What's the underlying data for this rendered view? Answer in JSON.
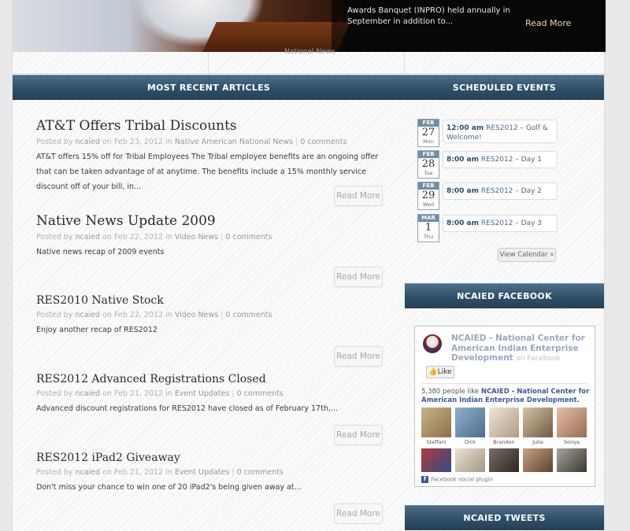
{
  "hero": {
    "caption_text": "Awards Banquet (INPRO) held annually in September in addition to...",
    "read_more": "Read More",
    "tab_label": "National News"
  },
  "sections": {
    "recent": "MOST RECENT ARTICLES",
    "events": "SCHEDULED EVENTS",
    "facebook": "NCAIED FACEBOOK",
    "tweets": "NCAIED TWEETS"
  },
  "articles": [
    {
      "title": "AT&T Offers Tribal Discounts",
      "posted_by": "Posted by",
      "author": "ncaied",
      "on": "on Feb 23, 2012 in",
      "category": "Native American National News",
      "comments": "0 comments",
      "excerpt": "AT&T offers 15% off for Tribal Employees The Tribal employee benefits are an ongoing offer that can be taken advantage of at anytime. The benefits include a 15% monthly service discount off of your bill, in...",
      "read_more": "Read More"
    },
    {
      "title": "Native News Update 2009",
      "posted_by": "Posted by",
      "author": "ncaied",
      "on": "on Feb 22, 2012 in",
      "category": "Video News",
      "comments": "0 comments",
      "excerpt": "Native news recap of 2009 events",
      "read_more": "Read More"
    },
    {
      "title": "RES2010 Native Stock",
      "posted_by": "Posted by",
      "author": "ncaied",
      "on": "on Feb 22, 2012 in",
      "category": "Video News",
      "comments": "0 comments",
      "excerpt": "Enjoy another recap of RES2012",
      "read_more": "Read More"
    },
    {
      "title": "RES2012 Advanced Registrations Closed",
      "posted_by": "Posted by",
      "author": "ncaied",
      "on": "on Feb 21, 2012 in",
      "category": "Event Updates",
      "comments": "0 comments",
      "excerpt": "Advanced discount registrations for RES2012 have closed as of February 17th,...",
      "read_more": "Read More"
    },
    {
      "title": "RES2012 iPad2 Giveaway",
      "posted_by": "Posted by",
      "author": "ncaied",
      "on": "on Feb 21, 2012 in",
      "category": "Event Updates",
      "comments": "0 comments",
      "excerpt": "Don't miss your chance to win one of 20 iPad2's being given away at...",
      "read_more": "Read More"
    }
  ],
  "events": [
    {
      "month": "FEB",
      "day": "27",
      "dow": "Mon",
      "time": "12:00 am",
      "title": "RES2012 – Golf & Welcome!"
    },
    {
      "month": "FEB",
      "day": "28",
      "dow": "Tue",
      "time": "8:00 am",
      "title": "RES2012 – Day 1"
    },
    {
      "month": "FEB",
      "day": "29",
      "dow": "Wed",
      "time": "8:00 am",
      "title": "RES2012 – Day 2"
    },
    {
      "month": "MAR",
      "day": "1",
      "dow": "Thu",
      "time": "8:00 am",
      "title": "RES2012 – Day 3"
    }
  ],
  "view_calendar": "View Calendar »",
  "facebook": {
    "page_name": "NCAIED - National Center for American Indian Enterprise Development",
    "on_facebook": "on Facebook",
    "like": "Like",
    "count_text": "5,380 people like",
    "count_page": "NCAIED - National Center for American Indian Enterprise Development.",
    "fans": [
      "Steffani",
      "Dick",
      "Brandon",
      "Julie",
      "Sonya"
    ],
    "plugin": "Facebook social plugin"
  }
}
